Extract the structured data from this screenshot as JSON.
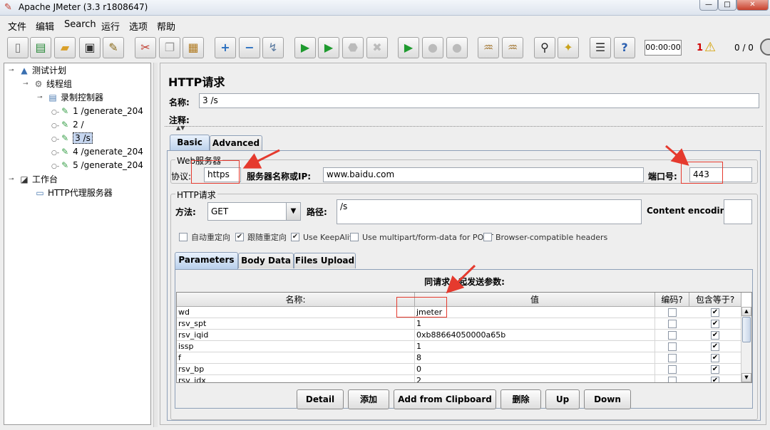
{
  "window": {
    "title": "Apache JMeter (3.3 r1808647)",
    "min": "—",
    "max": "□",
    "close": "✕"
  },
  "menu": [
    "文件",
    "编辑",
    "Search",
    "运行",
    "选项",
    "帮助"
  ],
  "toolbar": {
    "timer": "00:00:00",
    "errors": "1",
    "threads": "0 / 0"
  },
  "tree": {
    "test_plan": "测试计划",
    "thread_group": "线程组",
    "recording_controller": "录制控制器",
    "samplers": [
      "1 /generate_204",
      "2 /",
      "3 /s",
      "4 /generate_204",
      "5 /generate_204"
    ],
    "selected_index": 2,
    "workbench": "工作台",
    "proxy": "HTTP代理服务器"
  },
  "panel": {
    "title": "HTTP请求",
    "name_label": "名称:",
    "name_value": "3 /s",
    "comment_label": "注释:",
    "tabs": [
      "Basic",
      "Advanced"
    ],
    "web_server": {
      "title": "Web服务器",
      "protocol_label": "协议:",
      "protocol": "https",
      "server_label": "服务器名称或IP:",
      "server": "www.baidu.com",
      "port_label": "端口号:",
      "port": "443"
    },
    "http_request": {
      "title": "HTTP请求",
      "method_label": "方法:",
      "method": "GET",
      "path_label": "路径:",
      "path": "/s",
      "encoding_label": "Content encoding:",
      "encoding": ""
    },
    "options": [
      {
        "label": "自动重定向",
        "checked": false
      },
      {
        "label": "跟随重定向",
        "checked": true
      },
      {
        "label": "Use KeepAlive",
        "checked": true
      },
      {
        "label": "Use multipart/form-data for POST",
        "checked": false
      },
      {
        "label": "Browser-compatible headers",
        "checked": false
      }
    ],
    "sub_tabs": [
      "Parameters",
      "Body Data",
      "Files Upload"
    ],
    "params": {
      "title": "同请求一起发送参数:",
      "headers": [
        "名称:",
        "值",
        "编码?",
        "包含等于?"
      ],
      "rows": [
        {
          "name": "wd",
          "value": "jmeter",
          "encode": false,
          "include_equals": true
        },
        {
          "name": "rsv_spt",
          "value": "1",
          "encode": false,
          "include_equals": true
        },
        {
          "name": "rsv_iqid",
          "value": "0xb88664050000a65b",
          "encode": false,
          "include_equals": true
        },
        {
          "name": "issp",
          "value": "1",
          "encode": false,
          "include_equals": true
        },
        {
          "name": "f",
          "value": "8",
          "encode": false,
          "include_equals": true
        },
        {
          "name": "rsv_bp",
          "value": "0",
          "encode": false,
          "include_equals": true
        },
        {
          "name": "rsv_idx",
          "value": "2",
          "encode": false,
          "include_equals": true
        }
      ]
    },
    "buttons": [
      "Detail",
      "添加",
      "Add from Clipboard",
      "删除",
      "Up",
      "Down"
    ]
  },
  "colors": {
    "annotation": "#e53a2e",
    "selection": "#c7d7f0",
    "tab_active": "#b8cfeb"
  }
}
